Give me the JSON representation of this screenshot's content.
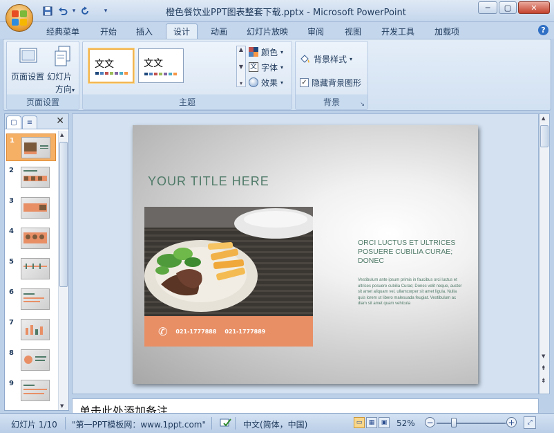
{
  "window": {
    "title": "橙色餐饮业PPT图表整套下载.pptx - Microsoft PowerPoint",
    "qat": {
      "save": "save-icon",
      "undo": "undo-icon",
      "redo": "redo-icon",
      "customize": "▾"
    },
    "controls": {
      "minimize": "─",
      "maximize": "▢",
      "close": "✕"
    }
  },
  "tabs": [
    {
      "label": "经典菜单",
      "active": false
    },
    {
      "label": "开始",
      "active": false
    },
    {
      "label": "插入",
      "active": false
    },
    {
      "label": "设计",
      "active": true
    },
    {
      "label": "动画",
      "active": false
    },
    {
      "label": "幻灯片放映",
      "active": false
    },
    {
      "label": "审阅",
      "active": false
    },
    {
      "label": "视图",
      "active": false
    },
    {
      "label": "开发工具",
      "active": false
    },
    {
      "label": "加载项",
      "active": false
    }
  ],
  "help": "?",
  "ribbon": {
    "page_setup": {
      "label": "页面设置",
      "page_setup_button": "页面设置",
      "orientation_line1": "幻灯片",
      "orientation_line2": "方向"
    },
    "themes": {
      "label": "主题",
      "items": [
        {
          "text": "文文",
          "selected": true,
          "swatches": [
            "#1f497d",
            "#4f81bd",
            "#c0504d",
            "#9bbb59",
            "#8064a2",
            "#4bacc6",
            "#f79646"
          ]
        },
        {
          "text": "文文",
          "selected": false,
          "swatches": [
            "#1f497d",
            "#4f81bd",
            "#c0504d",
            "#9bbb59",
            "#8064a2",
            "#4bacc6",
            "#f79646"
          ]
        }
      ],
      "colors": "颜色",
      "fonts": "字体",
      "effects": "效果"
    },
    "background": {
      "label": "背景",
      "styles": "背景样式",
      "hide_graphics": "隐藏背景图形",
      "hide_graphics_checked": true
    }
  },
  "thumbnails": [
    {
      "num": "1",
      "selected": true
    },
    {
      "num": "2",
      "selected": false
    },
    {
      "num": "3",
      "selected": false
    },
    {
      "num": "4",
      "selected": false
    },
    {
      "num": "5",
      "selected": false
    },
    {
      "num": "6",
      "selected": false
    },
    {
      "num": "7",
      "selected": false
    },
    {
      "num": "8",
      "selected": false
    },
    {
      "num": "9",
      "selected": false
    }
  ],
  "slide": {
    "title": "YOUR TITLE HERE",
    "phone1": "021-1777888",
    "phone2": "021-1777889",
    "heading": "ORCI LUCTUS ET ULTRICES POSUERE CUBILIA CURAE; DONEC",
    "body": "Vestibulum ante ipsum primis in faucibus orci luctus et ultrices posuere cubilia Curae; Donec velit neque, auctor sit amet aliquam vel, ullamcorper sit amet ligula. Nulla quis lorem ut libero malesuada feugiat. Vestibulum ac diam sit amet quam vehicula",
    "accent": "#e88f66",
    "text_color": "#4f7a68"
  },
  "notes": "单击此处添加备注",
  "status": {
    "slide": "幻灯片 1/10",
    "theme": "\"第一PPT模板网：www.1ppt.com\"",
    "language": "中文(简体，中国)",
    "zoom": "52%",
    "zoom_minus": "−",
    "zoom_plus": "+"
  }
}
